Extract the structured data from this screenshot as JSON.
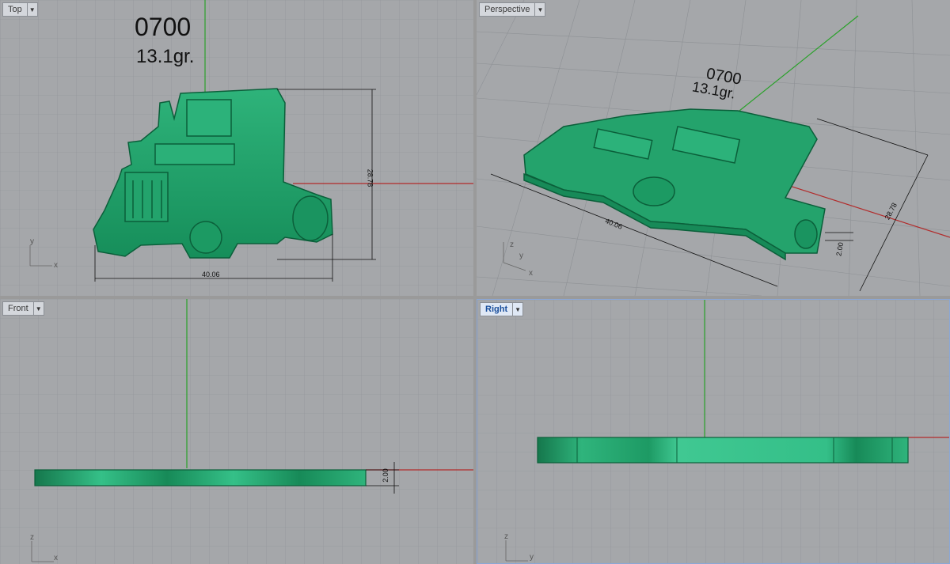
{
  "viewports": {
    "top": {
      "label": "Top",
      "part_code": "0700",
      "weight": "13.1gr.",
      "dim_width": "40.06",
      "dim_height": "28.78",
      "axis_x": "x",
      "axis_y": "y"
    },
    "perspective": {
      "label": "Perspective",
      "part_code": "0700",
      "weight": "13.1gr.",
      "dim_width": "40.06",
      "dim_height": "28.78",
      "dim_thickness": "2.00",
      "axis_x": "x",
      "axis_y": "y",
      "axis_z": "z"
    },
    "front": {
      "label": "Front",
      "dim_thickness": "2.00",
      "axis_x": "x",
      "axis_z": "z"
    },
    "right": {
      "label": "Right",
      "axis_y": "y",
      "axis_z": "z"
    }
  },
  "colors": {
    "background_grid": "#a5a7aa",
    "model": "#1f9a67",
    "axis_x": "#b22b2b",
    "axis_y": "#2aa12a",
    "active_viewport": "#1a4f9c"
  },
  "icons": {
    "viewport_menu": "caret-down-icon"
  }
}
